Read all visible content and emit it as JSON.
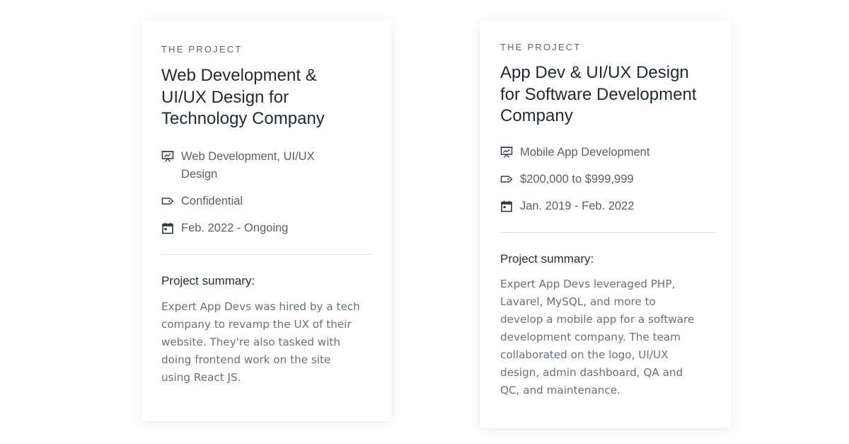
{
  "colors": {
    "heading": "#1e2b35",
    "body": "#56616b",
    "muted": "#66727c",
    "icon": "#2f3a44",
    "divider": "#e3e7ea"
  },
  "cards": [
    {
      "eyebrow": "THE PROJECT",
      "title": "Web Development & UI/UX Design for Technology Company",
      "meta": [
        {
          "icon": "presentation-icon",
          "text": "Web Development, UI/UX Design"
        },
        {
          "icon": "price-tag-icon",
          "text": "Confidential"
        },
        {
          "icon": "calendar-icon",
          "text": "Feb. 2022 - Ongoing"
        }
      ],
      "summary_label": "Project summary:",
      "summary_text": "Expert App Devs was hired by a tech company to revamp the UX of their website. They're also tasked with doing frontend work on the site using React JS."
    },
    {
      "eyebrow": "THE PROJECT",
      "title": "App Dev & UI/UX Design for Software Development Company",
      "meta": [
        {
          "icon": "presentation-icon",
          "text": "Mobile App Development"
        },
        {
          "icon": "price-tag-icon",
          "text": "$200,000 to $999,999"
        },
        {
          "icon": "calendar-icon",
          "text": "Jan. 2019 - Feb. 2022"
        }
      ],
      "summary_label": "Project summary:",
      "summary_text": "Expert App Devs leveraged PHP, Lavarel, MySQL, and more to develop a mobile app for a software development company. The team collaborated on the logo, UI/UX design, admin dashboard, QA and QC, and maintenance."
    }
  ]
}
